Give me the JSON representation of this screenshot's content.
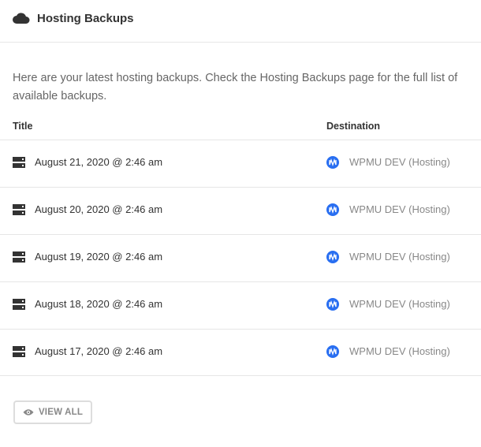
{
  "header": {
    "title": "Hosting Backups",
    "icon": "cloud-icon"
  },
  "intro": "Here are your latest hosting backups. Check the Hosting Backups page for the full list of available backups.",
  "columns": {
    "title": "Title",
    "destination": "Destination"
  },
  "backups": [
    {
      "date": "August 21, 2020 @ 2:46 am",
      "destination": "WPMU DEV (Hosting)"
    },
    {
      "date": "August 20, 2020 @ 2:46 am",
      "destination": "WPMU DEV (Hosting)"
    },
    {
      "date": "August 19, 2020 @ 2:46 am",
      "destination": "WPMU DEV (Hosting)"
    },
    {
      "date": "August 18, 2020 @ 2:46 am",
      "destination": "WPMU DEV (Hosting)"
    },
    {
      "date": "August 17, 2020 @ 2:46 am",
      "destination": "WPMU DEV (Hosting)"
    }
  ],
  "view_all_label": "VIEW ALL",
  "colors": {
    "accent": "#286ef1",
    "text": "#333333",
    "muted": "#888888",
    "border": "#e6e6e6"
  }
}
